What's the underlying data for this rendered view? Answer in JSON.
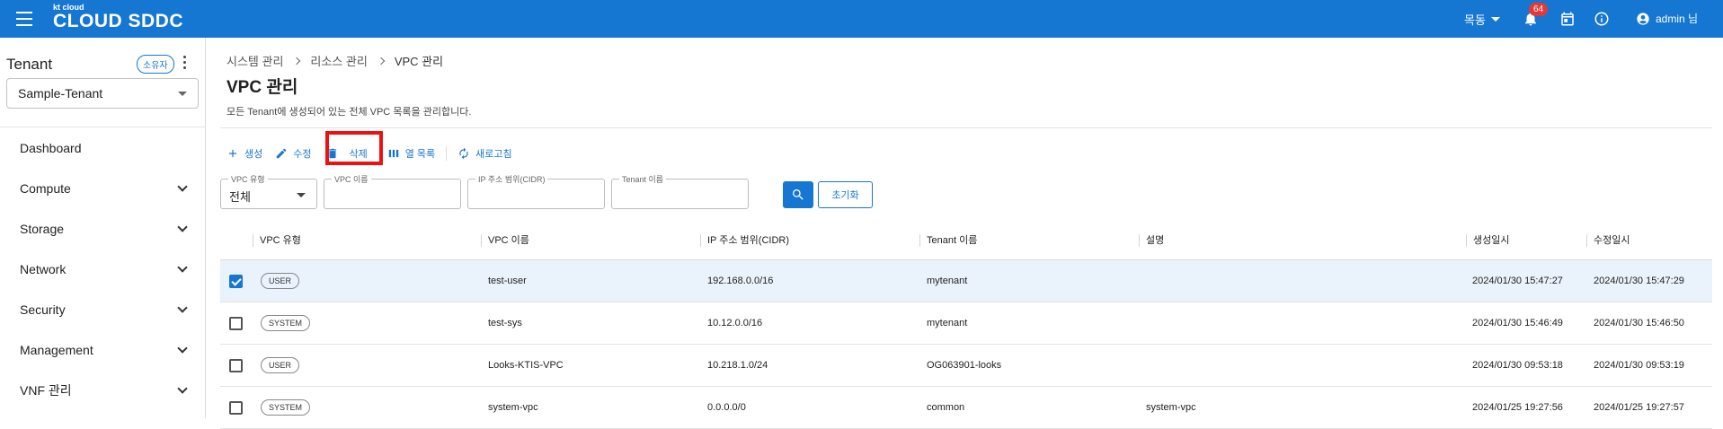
{
  "header": {
    "logo_small": "kt cloud",
    "logo_brand": "CLOUD SDDC",
    "region": "목동",
    "notification_count": "64",
    "user": "admin 님"
  },
  "sidebar": {
    "tenant_title": "Tenant",
    "owner_badge": "소유자",
    "tenant_selected": "Sample-Tenant",
    "items": [
      {
        "label": "Dashboard"
      },
      {
        "label": "Compute"
      },
      {
        "label": "Storage"
      },
      {
        "label": "Network"
      },
      {
        "label": "Security"
      },
      {
        "label": "Management"
      },
      {
        "label": "VNF 관리"
      }
    ]
  },
  "breadcrumb": [
    "시스템 관리",
    "리소스 관리",
    "VPC 관리"
  ],
  "page": {
    "title": "VPC 관리",
    "description": "모든 Tenant에 생성되어 있는 전체 VPC 목록을 관리합니다."
  },
  "toolbar": {
    "create": "생성",
    "edit": "수정",
    "delete": "삭제",
    "columns": "열 목록",
    "refresh": "새로고침"
  },
  "filters": {
    "vpc_type_label": "VPC 유형",
    "vpc_type_value": "전체",
    "vpc_name_label": "VPC 이름",
    "cidr_label": "IP 주소 범위(CIDR)",
    "tenant_label": "Tenant 이름",
    "reset": "초기화"
  },
  "table": {
    "columns": [
      "VPC 유형",
      "VPC 이름",
      "IP 주소 범위(CIDR)",
      "Tenant 이름",
      "설명",
      "생성일시",
      "수정일시"
    ],
    "rows": [
      {
        "checked": true,
        "type": "USER",
        "name": "test-user",
        "cidr": "192.168.0.0/16",
        "tenant": "mytenant",
        "desc": "",
        "created": "2024/01/30 15:47:27",
        "updated": "2024/01/30 15:47:29"
      },
      {
        "checked": false,
        "type": "SYSTEM",
        "name": "test-sys",
        "cidr": "10.12.0.0/16",
        "tenant": "mytenant",
        "desc": "",
        "created": "2024/01/30 15:46:49",
        "updated": "2024/01/30 15:46:50"
      },
      {
        "checked": false,
        "type": "USER",
        "name": "Looks-KTIS-VPC",
        "cidr": "10.218.1.0/24",
        "tenant": "OG063901-looks",
        "desc": "",
        "created": "2024/01/30 09:53:18",
        "updated": "2024/01/30 09:53:19"
      },
      {
        "checked": false,
        "type": "SYSTEM",
        "name": "system-vpc",
        "cidr": "0.0.0.0/0",
        "tenant": "common",
        "desc": "system-vpc",
        "created": "2024/01/25 19:27:56",
        "updated": "2024/01/25 19:27:57"
      }
    ]
  },
  "colors": {
    "primary": "#1677d2",
    "highlight": "#ee1111",
    "selected_row": "#eaf2fb"
  }
}
